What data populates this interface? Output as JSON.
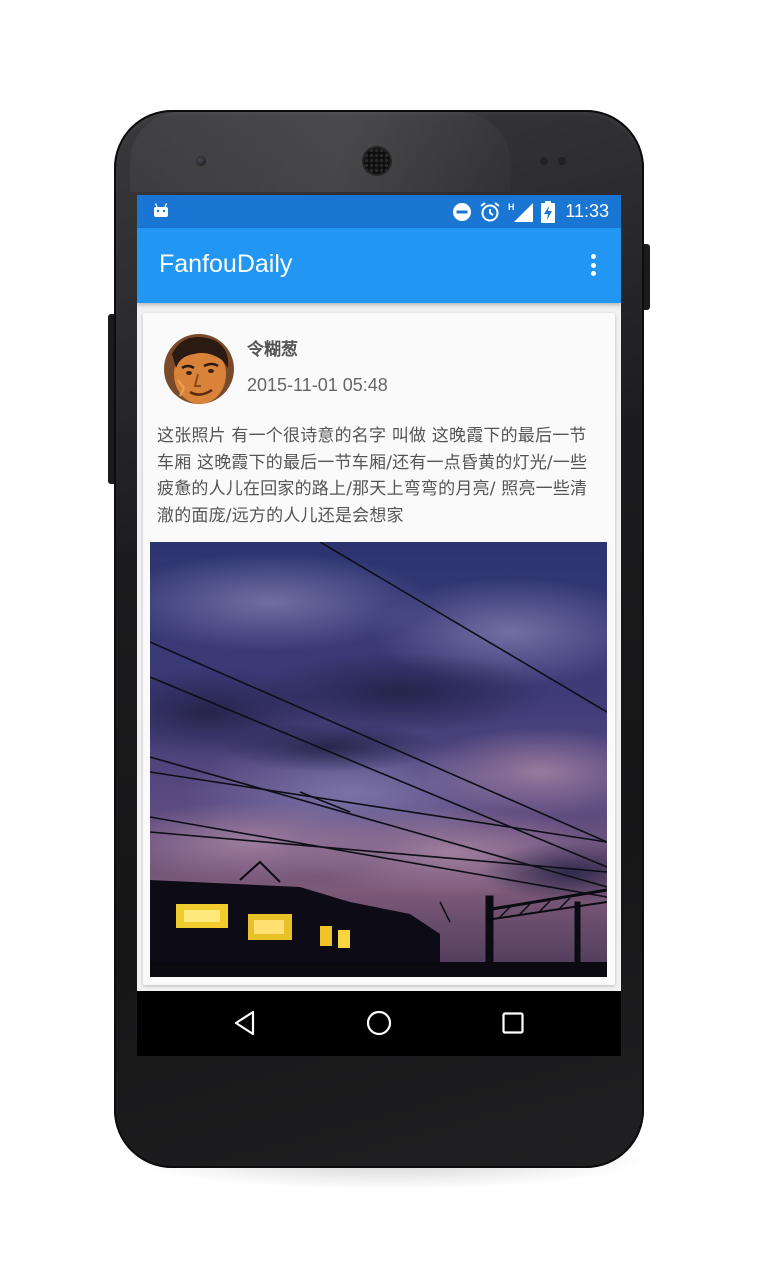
{
  "status_bar": {
    "time": "11:33",
    "network_label": "H",
    "icons": [
      "android-notification-icon",
      "do-not-disturb-icon",
      "alarm-icon",
      "signal-icon",
      "battery-charging-icon"
    ]
  },
  "app_bar": {
    "title": "FanfouDaily",
    "menu_icon": "overflow-menu-icon"
  },
  "post": {
    "username": "令糊葱",
    "timestamp": "2015-11-01 05:48",
    "text": "这张照片 有一个很诗意的名字 叫做 这晚霞下的最后一节车厢 这晚霞下的最后一节车厢/还有一点昏黄的灯光/一些疲惫的人儿在回家的路上/那天上弯弯的月亮/ 照亮一些清澈的面庞/远方的人儿还是会想家",
    "photo_icon": "evening-train-photo"
  },
  "nav_bar": {
    "back_icon": "back-icon",
    "home_icon": "home-icon",
    "recents_icon": "recents-icon"
  },
  "colors": {
    "status_bar": "#1976d2",
    "app_bar": "#2196f3",
    "card": "#fafafa",
    "screen_bg": "#f1f1f1"
  }
}
